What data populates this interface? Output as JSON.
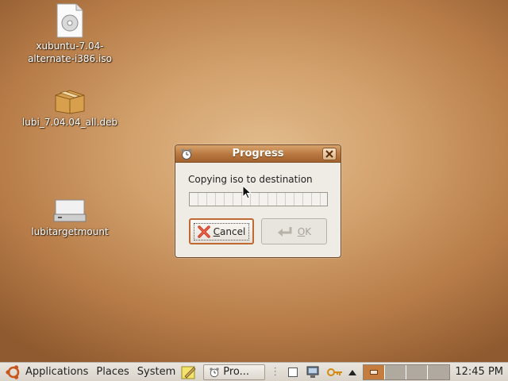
{
  "desktop": {
    "icons": [
      {
        "label_line1": "xubuntu-7.04-",
        "label_line2": "alternate-i386.iso",
        "icon": "cd-disc-file-icon"
      },
      {
        "label": "lubi_7.04.04_all.deb",
        "icon": "package-box-icon"
      },
      {
        "label": "lubitargetmount",
        "icon": "drive-icon"
      }
    ]
  },
  "dialog": {
    "title": "Progress",
    "message": "Copying iso to destination",
    "progress_fraction": 0.0,
    "cancel": {
      "mnemonic": "C",
      "rest": "ancel"
    },
    "ok": {
      "mnemonic": "O",
      "rest": "K"
    }
  },
  "panel": {
    "menus": [
      "Applications",
      "Places",
      "System"
    ],
    "task_label": "Pro...",
    "clock": "12:45 PM",
    "workspaces": 4,
    "active_workspace": 1
  },
  "colors": {
    "title_bar": "#b8773f",
    "accent": "#c06a32",
    "desktop": "#d2a16c"
  }
}
